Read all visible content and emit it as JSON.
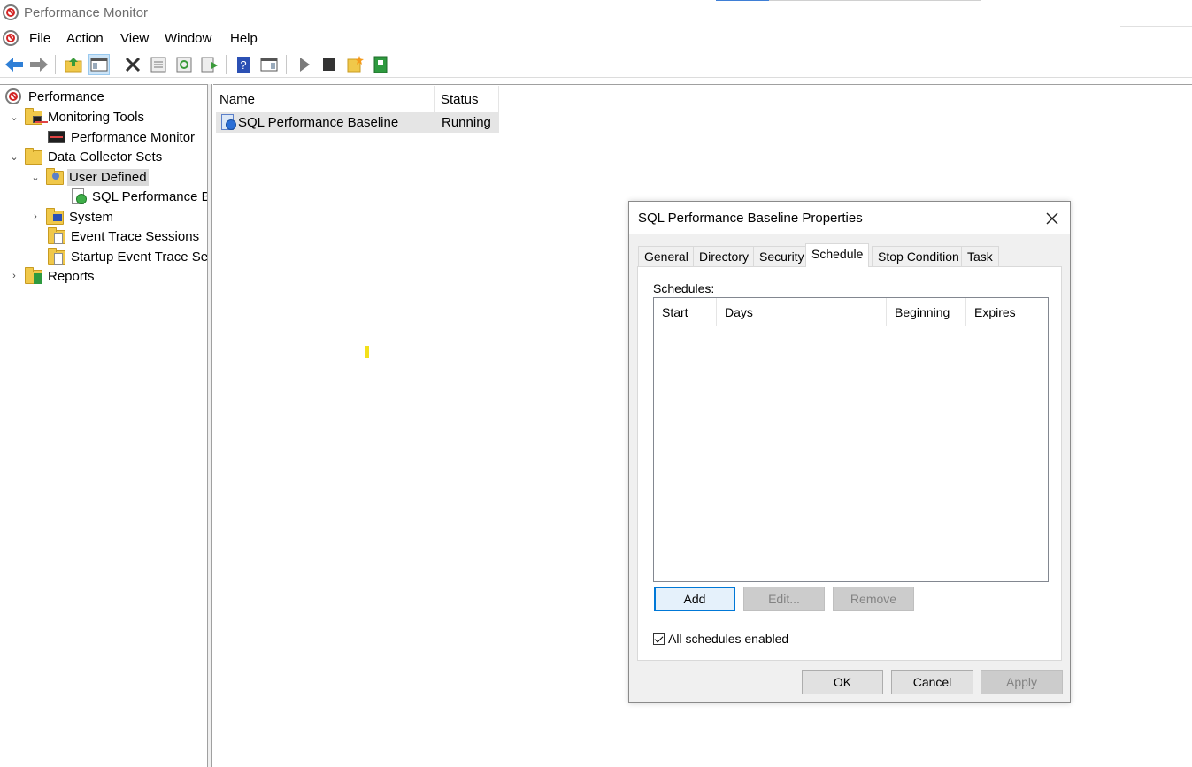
{
  "window": {
    "title": "Performance Monitor"
  },
  "menu": [
    "File",
    "Action",
    "View",
    "Window",
    "Help"
  ],
  "toolbar": {
    "buttons": [
      "back-icon",
      "forward-icon",
      "up-folder-icon",
      "show-hide-tree-icon",
      "delete-icon",
      "properties-icon",
      "refresh-icon",
      "export-list-icon",
      "help-icon",
      "show-hide-action-pane-icon",
      "start-icon",
      "stop-icon",
      "new-icon",
      "report-icon"
    ]
  },
  "tree": {
    "root": "Performance",
    "monitoring_tools": "Monitoring Tools",
    "performance_monitor": "Performance Monitor",
    "data_collector_sets": "Data Collector Sets",
    "user_defined": "User Defined",
    "sql_baseline": "SQL Performance Ba",
    "system": "System",
    "event_trace_sessions": "Event Trace Sessions",
    "startup_event_trace": "Startup Event Trace Sess",
    "reports": "Reports"
  },
  "list": {
    "columns": {
      "name": "Name",
      "status": "Status"
    },
    "rows": [
      {
        "name": "SQL Performance Baseline",
        "status": "Running"
      }
    ]
  },
  "dialog": {
    "title": "SQL Performance Baseline Properties",
    "tabs": [
      "General",
      "Directory",
      "Security",
      "Schedule",
      "Stop Condition",
      "Task"
    ],
    "active_tab": "Schedule",
    "schedules_label": "Schedules:",
    "schedule_columns": [
      "Start",
      "Days",
      "Beginning",
      "Expires"
    ],
    "buttons": {
      "add": "Add",
      "edit": "Edit...",
      "remove": "Remove"
    },
    "all_schedules_enabled": {
      "label": "All schedules enabled",
      "checked": true
    },
    "footer": {
      "ok": "OK",
      "cancel": "Cancel",
      "apply": "Apply"
    }
  }
}
